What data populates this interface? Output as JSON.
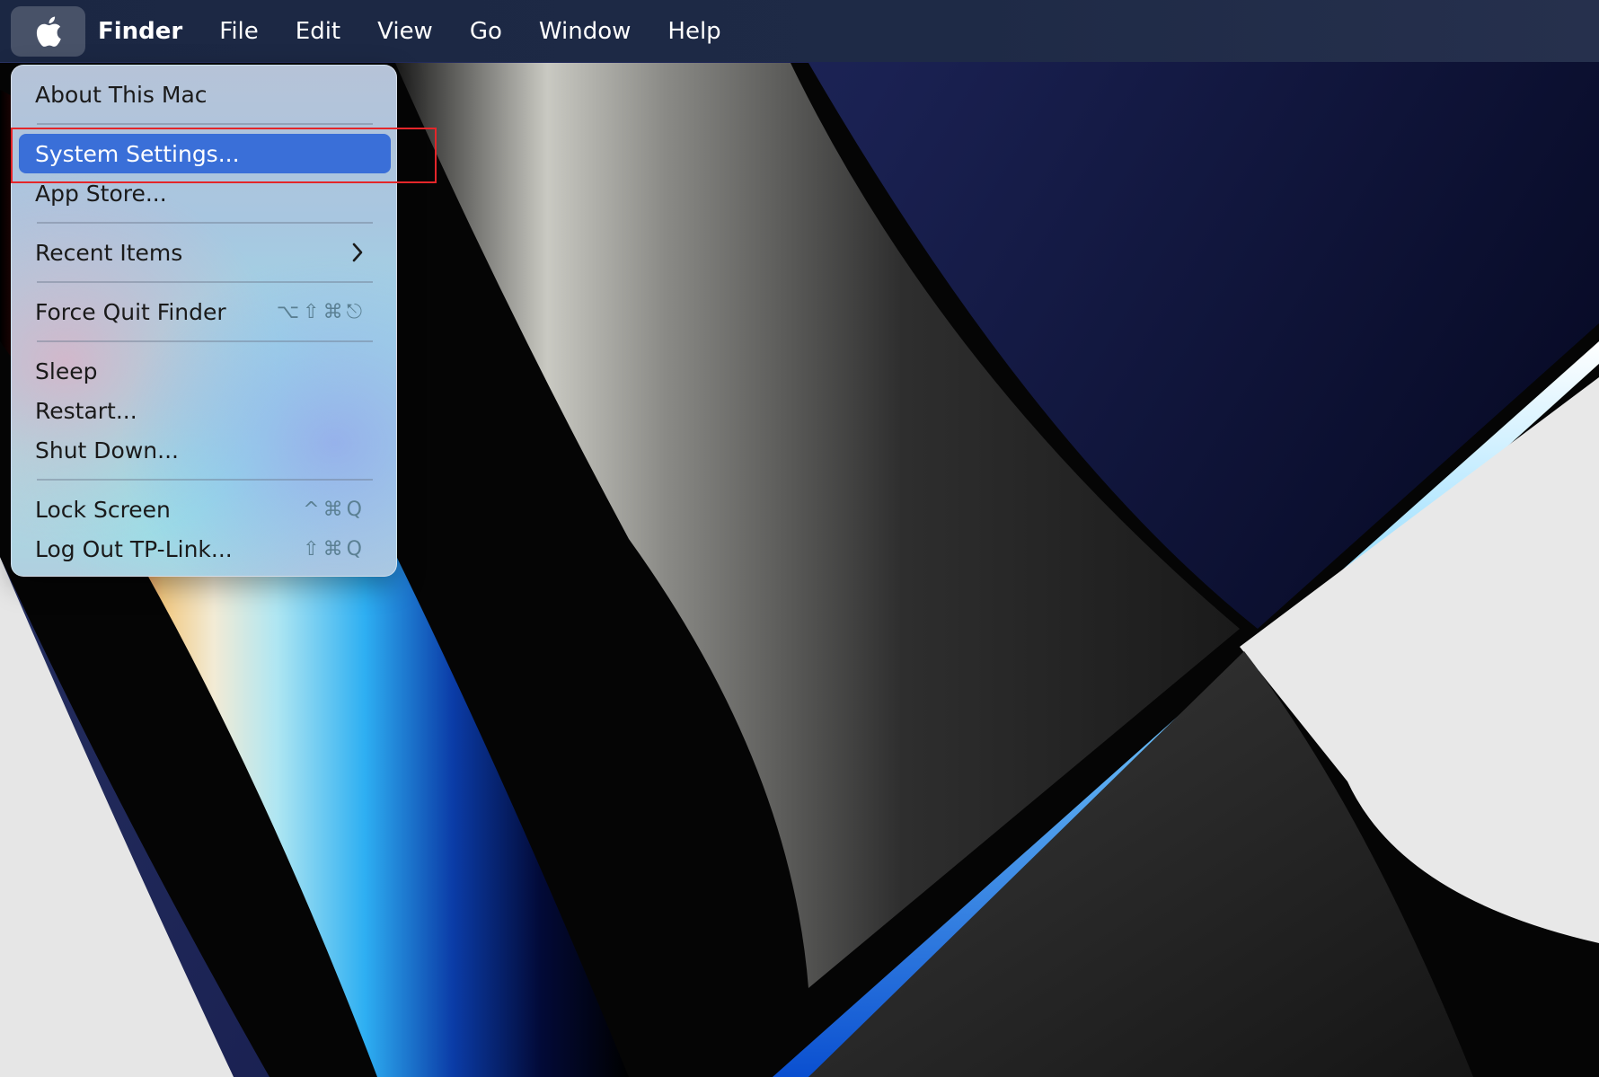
{
  "menubar": {
    "apple_icon": "apple-logo-icon",
    "items": [
      "Finder",
      "File",
      "Edit",
      "View",
      "Go",
      "Window",
      "Help"
    ]
  },
  "apple_menu": {
    "items": [
      {
        "label": "About This Mac"
      },
      {
        "label": "System Settings...",
        "selected": true
      },
      {
        "label": "App Store..."
      },
      {
        "label": "Recent Items",
        "submenu_icon": "chevron-right-icon"
      },
      {
        "label": "Force Quit Finder",
        "shortcut": "⌥⇧⌘⎋"
      },
      {
        "label": "Sleep"
      },
      {
        "label": "Restart..."
      },
      {
        "label": "Shut Down..."
      },
      {
        "label": "Lock Screen",
        "shortcut": "^⌘Q"
      },
      {
        "label": "Log Out TP-Link...",
        "shortcut": "⇧⌘Q"
      }
    ]
  },
  "colors": {
    "menubar_bg": "#1e2a46",
    "selection": "#3a6fd8",
    "annotation_box": "#e4262a"
  }
}
